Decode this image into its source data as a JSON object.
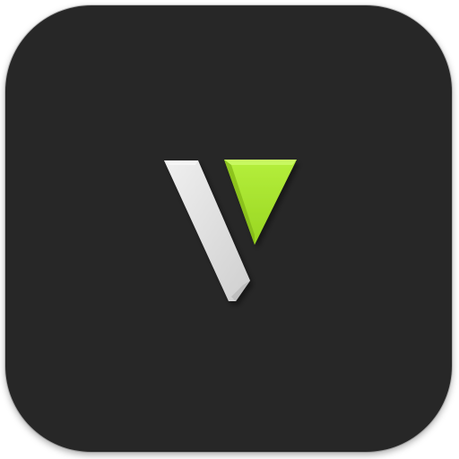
{
  "app_icon": {
    "tile_color": "#272727",
    "logo": {
      "icon": "v-logo-icon",
      "left_stroke_color": "#e0e0e0",
      "triangle_color": "#a6e22e",
      "triangle_shadow_color": "#6a9a12"
    }
  }
}
